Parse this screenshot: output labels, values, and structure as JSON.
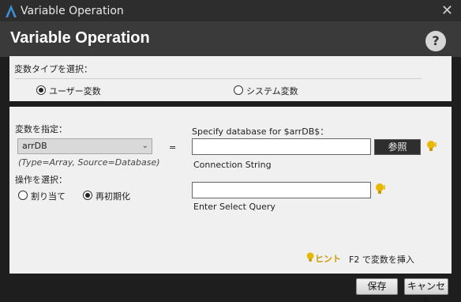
{
  "window": {
    "title": "Variable Operation",
    "close_glyph": "✕",
    "app_icon": "app-logo-icon"
  },
  "header": {
    "title": "Variable Operation",
    "help_glyph": "?"
  },
  "variable_type": {
    "label": "変数タイプを選択：",
    "options": [
      {
        "label": "ユーザー変数",
        "selected": true
      },
      {
        "label": "システム変数",
        "selected": false
      }
    ]
  },
  "variable": {
    "label": "変数を指定：",
    "selected": "arrDB",
    "info": "(Type=Array, Source=Database)",
    "equals": "="
  },
  "operation": {
    "label": "操作を選択：",
    "options": [
      {
        "label": "割り当て",
        "selected": false
      },
      {
        "label": "再初期化",
        "selected": true
      }
    ]
  },
  "database": {
    "label": "Specify database for $arrDB$：",
    "connection_value": "",
    "connection_caption": "Connection String",
    "browse_label": "参照",
    "query_value": "",
    "query_caption": "Enter Select Query"
  },
  "hint": {
    "label": "ヒント",
    "text": "F2 で変数を挿入"
  },
  "footer": {
    "save_label": "保存",
    "cancel_label": "キャンセル"
  },
  "colors": {
    "background": "#1e1e1e",
    "header": "#3a3a3a",
    "panel": "#f0f0f0",
    "hint": "#e8b800",
    "accent": "#3c8fd6"
  }
}
